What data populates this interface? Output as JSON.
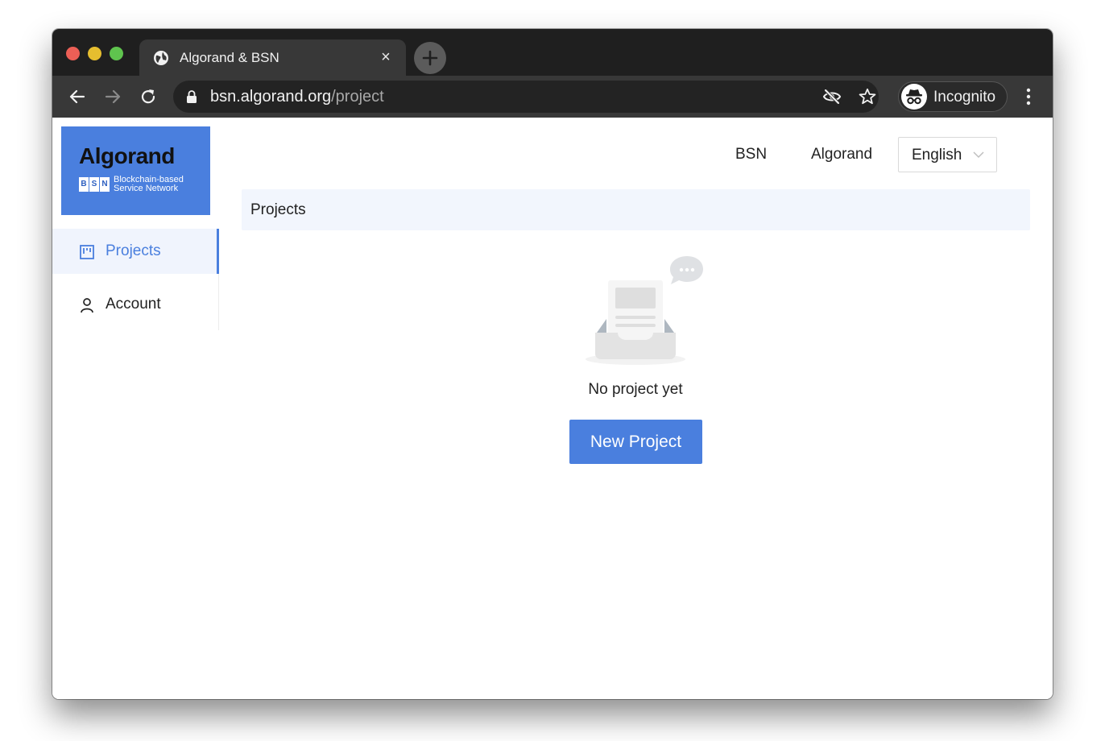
{
  "browser": {
    "tab_title": "Algorand & BSN",
    "tab_close_glyph": "×",
    "url_host": "bsn.algorand.org",
    "url_path": "/project",
    "incognito_label": "Incognito",
    "icons": [
      "globe-icon",
      "new-tab-plus-icon",
      "back-arrow-icon",
      "forward-arrow-icon",
      "reload-icon",
      "lock-icon",
      "eye-off-icon",
      "star-icon",
      "incognito-icon",
      "more-vertical-icon"
    ]
  },
  "logo": {
    "wordmark": "Algorand",
    "bsn_letters": [
      "B",
      "S",
      "N"
    ],
    "bsn_line1": "Blockchain-based",
    "bsn_line2": "Service Network",
    "background_color": "#4a7fde"
  },
  "sidebar": {
    "items": [
      {
        "label": "Projects",
        "icon": "projects-icon",
        "active": true
      },
      {
        "label": "Account",
        "icon": "user-icon",
        "active": false
      }
    ]
  },
  "topnav": {
    "links": [
      "BSN",
      "Algorand"
    ],
    "language": "English"
  },
  "breadcrumb": "Projects",
  "empty_state": {
    "text": "No project yet",
    "icon": "empty-inbox-icon"
  },
  "new_project_label": "New Project",
  "colors": {
    "accent": "#4a7fde",
    "active_item_bg": "#f0f4fd",
    "breadcrumb_bg": "#f2f6fd"
  }
}
